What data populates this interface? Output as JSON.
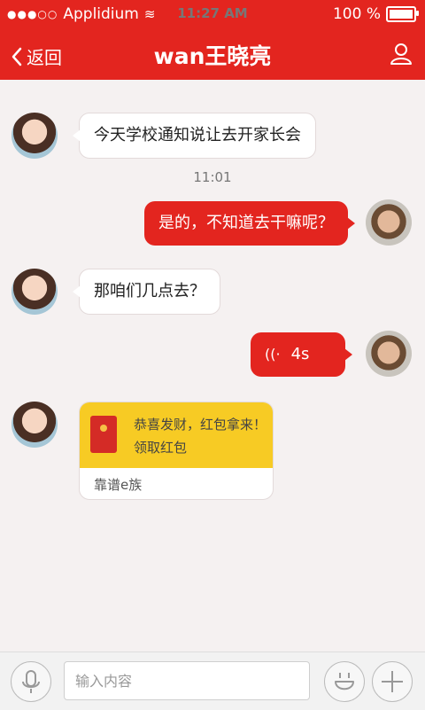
{
  "status": {
    "carrier": "Applidium",
    "time": "11:27 AM",
    "battery": "100 %"
  },
  "nav": {
    "back_label": "返回",
    "title": "wan王晓亮"
  },
  "messages": [
    {
      "side": "left",
      "text": "今天学校通知说让去开家长会"
    },
    {
      "side": "right",
      "text": "是的，不知道去干嘛呢？"
    },
    {
      "side": "left",
      "text": "那咱们几点去？"
    },
    {
      "side": "right",
      "type": "voice",
      "duration": "4s"
    }
  ],
  "timestamp": "11:01",
  "redpacket": {
    "title": "恭喜发财，红包拿来！",
    "action": "领取红包",
    "footer": "靠谱e族"
  },
  "input": {
    "placeholder": "输入内容"
  }
}
